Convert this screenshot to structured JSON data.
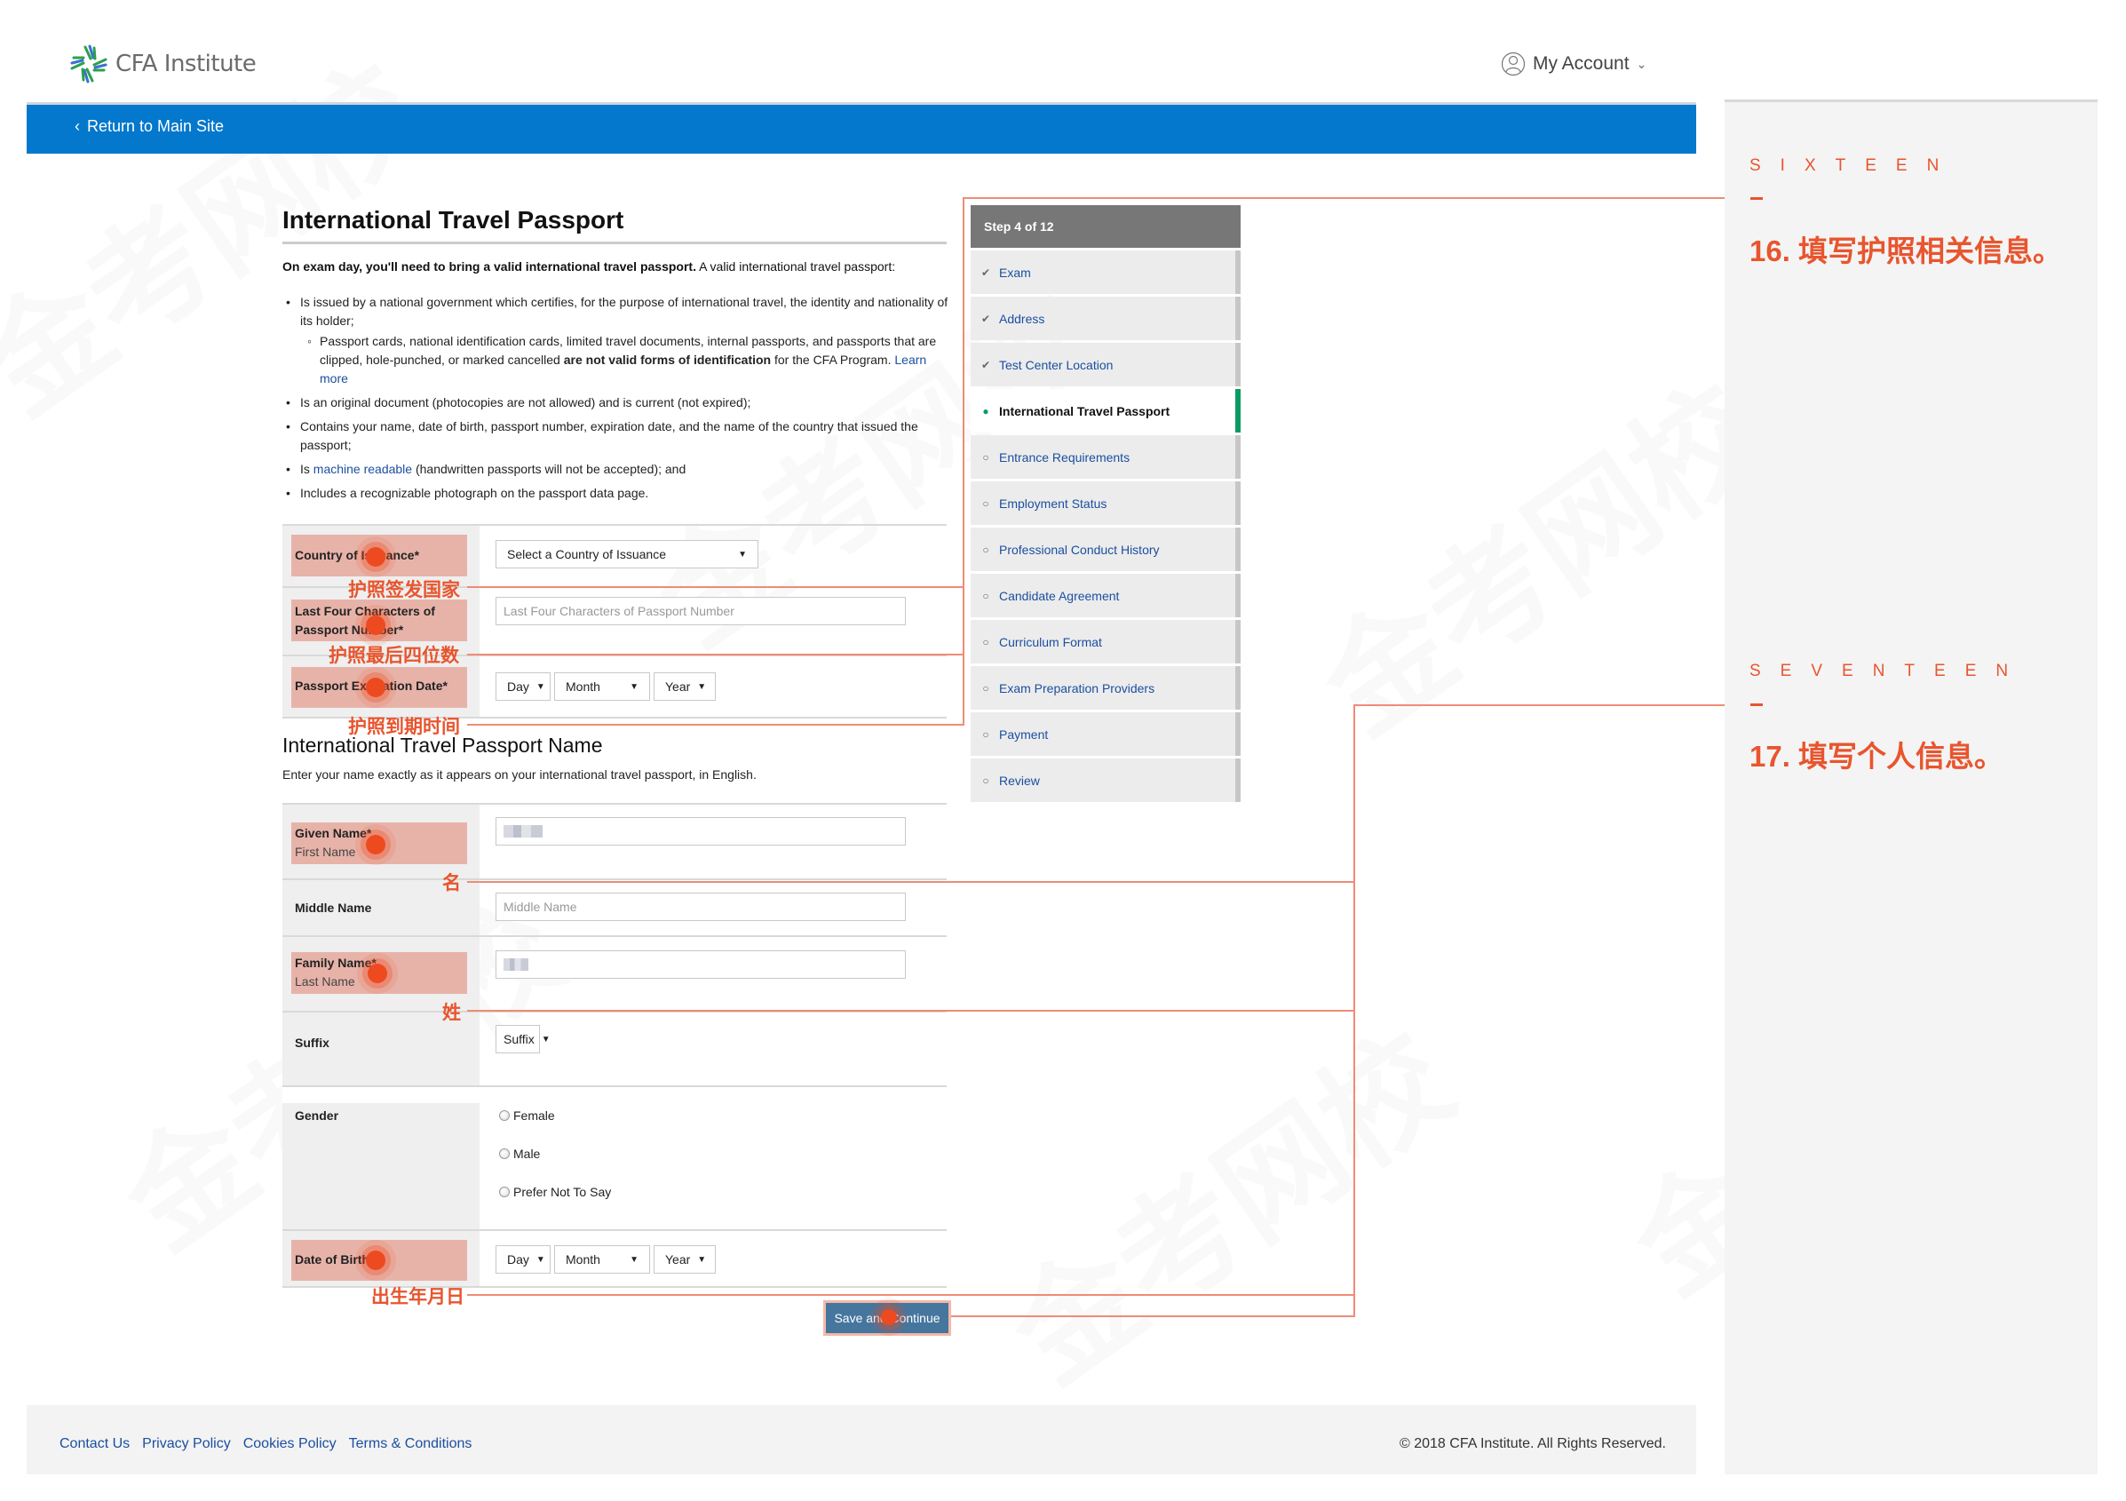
{
  "header": {
    "brand": "CFA Institute",
    "account_label": "My Account",
    "return_link": "Return to Main Site"
  },
  "page": {
    "title": "International Travel Passport",
    "intro_bold": "On exam day, you'll need to bring a valid international travel passport.",
    "intro_rest": " A valid international travel passport:",
    "requirements": {
      "r1": "Is issued by a national government which certifies, for the purpose of international travel, the identity and nationality of its holder;",
      "r1_sub_a": "Passport cards, national identification cards, limited travel documents, internal passports, and passports that are clipped, hole-punched, or marked cancelled ",
      "r1_sub_bold": "are not valid forms of identification",
      "r1_sub_b": " for the CFA Program. ",
      "r1_sub_link": "Learn more",
      "r2": "Is an original document (photocopies are not allowed) and is current (not expired);",
      "r3": "Contains your name, date of birth, passport number, expiration date, and the name of the country that issued the passport;",
      "r4_a": "Is ",
      "r4_link": "machine readable",
      "r4_b": " (handwritten passports will not be accepted); and",
      "r5": "Includes a recognizable photograph on the passport data page."
    }
  },
  "passport_form": {
    "country_label": "Country of Issuance*",
    "country_select": "Select a Country of Issuance",
    "last_four_label_1": "Last Four Characters of",
    "last_four_label_2": "Passport Number*",
    "last_four_placeholder": "Last Four Characters of Passport Number",
    "expiration_label": "Passport Expiration Date*",
    "day": "Day",
    "month": "Month",
    "year": "Year"
  },
  "name_form": {
    "title": "International Travel Passport Name",
    "subtitle": "Enter your name exactly as it appears on your international travel passport, in English.",
    "given_label": "Given Name*",
    "given_sub": "First Name",
    "middle_label": "Middle Name",
    "middle_placeholder": "Middle Name",
    "family_label": "Family Name*",
    "family_sub": "Last Name",
    "suffix_label": "Suffix",
    "suffix_select": "Suffix",
    "gender_label": "Gender",
    "gender_options": [
      "Female",
      "Male",
      "Prefer Not To Say"
    ],
    "dob_label": "Date of Birth*",
    "day": "Day",
    "month": "Month",
    "year": "Year",
    "save_button": "Save and Continue"
  },
  "stepper": {
    "header": "Step 4 of 12",
    "items": [
      {
        "label": "Exam",
        "state": "done"
      },
      {
        "label": "Address",
        "state": "done"
      },
      {
        "label": "Test Center Location",
        "state": "done"
      },
      {
        "label": "International Travel Passport",
        "state": "current"
      },
      {
        "label": "Entrance Requirements",
        "state": "todo"
      },
      {
        "label": "Employment Status",
        "state": "todo"
      },
      {
        "label": "Professional Conduct History",
        "state": "todo"
      },
      {
        "label": "Candidate Agreement",
        "state": "todo"
      },
      {
        "label": "Curriculum Format",
        "state": "todo"
      },
      {
        "label": "Exam Preparation Providers",
        "state": "todo"
      },
      {
        "label": "Payment",
        "state": "todo"
      },
      {
        "label": "Review",
        "state": "todo"
      }
    ]
  },
  "annotations": {
    "country": "护照签发国家",
    "last_four": "护照最后四位数",
    "expiration": "护照到期时间",
    "given": "名",
    "family": "姓",
    "dob": "出生年月日",
    "step16_word": "SIXTEEN",
    "step16_title": "16. 填写护照相关信息。",
    "step17_word": "SEVENTEEN",
    "step17_title": "17. 填写个人信息。"
  },
  "footer": {
    "links": [
      "Contact Us",
      "Privacy Policy",
      "Cookies Policy",
      "Terms & Conditions"
    ],
    "copyright": "© 2018 CFA Institute. All Rights Reserved."
  },
  "watermark": "金考网校",
  "colors": {
    "brand_blue": "#0378cc",
    "annotation": "#e8552e",
    "current_step": "#0a9b63",
    "button": "#45769e"
  }
}
